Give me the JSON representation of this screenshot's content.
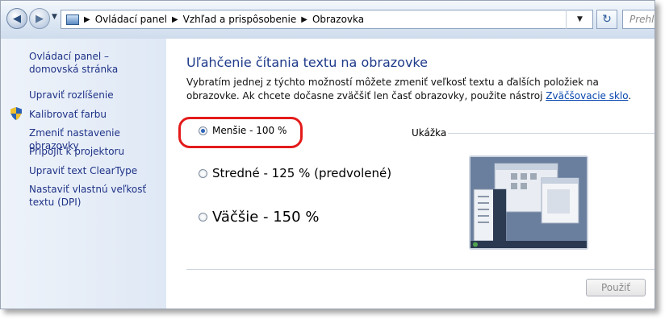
{
  "address_bar": {
    "breadcrumbs": [
      "Ovládací panel",
      "Vzhľad a prispôsobenie",
      "Obrazovka"
    ],
    "search_placeholder": "Prehľ"
  },
  "sidebar": {
    "items": [
      {
        "label": "Ovládací panel – domovská stránka"
      },
      {
        "label": "Upraviť rozlíšenie"
      },
      {
        "label": "Kalibrovať farbu"
      },
      {
        "label": "Zmeniť nastavenie obrazovky"
      },
      {
        "label": "Pripojiť k projektoru"
      },
      {
        "label": "Upraviť text ClearType"
      },
      {
        "label": "Nastaviť vlastnú veľkosť textu (DPI)"
      }
    ]
  },
  "main": {
    "title": "Uľahčenie čítania textu na obrazovke",
    "description": "Vybratím jednej z týchto možností môžete zmeniť veľkosť textu a ďalších položiek na obrazovke. Ak chcete dočasne zväčšiť len časť obrazovky, použite nástroj ",
    "description_link": "Zväčšovacie sklo",
    "description_end": ".",
    "options": [
      {
        "label": "Menšie - 100 %",
        "checked": true
      },
      {
        "label": "Stredné - 125 % (predvolené)",
        "checked": false
      },
      {
        "label": "Väčšie - 150 %",
        "checked": false
      }
    ],
    "preview_label": "Ukážka",
    "apply_button": "Použiť"
  },
  "colors": {
    "link": "#1e3287",
    "title": "#1e3a8a",
    "highlight_ring": "#e41b1b"
  }
}
